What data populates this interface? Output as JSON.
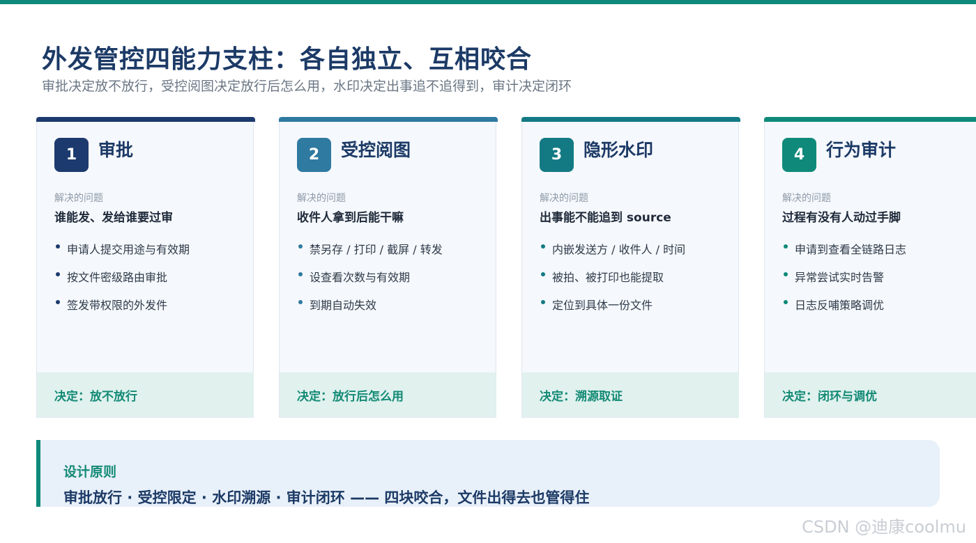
{
  "colors": {
    "accent_teal": "#0f8a7a",
    "navy": "#1c3a66",
    "card_bg": "#f5f8fc",
    "decision_bg": "#e0f1ee",
    "principle_bg": "#e8f0f9"
  },
  "title": "外发管控四能力支柱：各自独立、互相咬合",
  "subtitle": "审批决定放不放行，受控阅图决定放行后怎么用，水印决定出事追不追得到，审计决定闭环",
  "cards": [
    {
      "number": "1",
      "title": "审批",
      "color": "#1c3a6e",
      "label": "解决的问题",
      "problem": "谁能发、发给谁要过审",
      "bullets": [
        "申请人提交用途与有效期",
        "按文件密级路由审批",
        "签发带权限的外发件"
      ],
      "decision": "决定：放不放行"
    },
    {
      "number": "2",
      "title": "受控阅图",
      "color": "#2f7aa0",
      "label": "解决的问题",
      "problem": "收件人拿到后能干嘛",
      "bullets": [
        "禁另存 / 打印 / 截屏 / 转发",
        "设查看次数与有效期",
        "到期自动失效"
      ],
      "decision": "决定：放行后怎么用"
    },
    {
      "number": "3",
      "title": "隐形水印",
      "color": "#137a84",
      "label": "解决的问题",
      "problem": "出事能不能追到 source",
      "bullets": [
        "内嵌发送方 / 收件人 / 时间",
        "被拍、被打印也能提取",
        "定位到具体一份文件"
      ],
      "decision": "决定：溯源取证"
    },
    {
      "number": "4",
      "title": "行为审计",
      "color": "#0f8a7a",
      "label": "解决的问题",
      "problem": "过程有没有人动过手脚",
      "bullets": [
        "申请到查看全链路日志",
        "异常尝试实时告警",
        "日志反哺策略调优"
      ],
      "decision": "决定：闭环与调优"
    }
  ],
  "principle": {
    "label": "设计原则",
    "text": "审批放行 · 受控限定 · 水印溯源 · 审计闭环 —— 四块咬合，文件出得去也管得住"
  },
  "watermark": "CSDN @迪康coolmu"
}
